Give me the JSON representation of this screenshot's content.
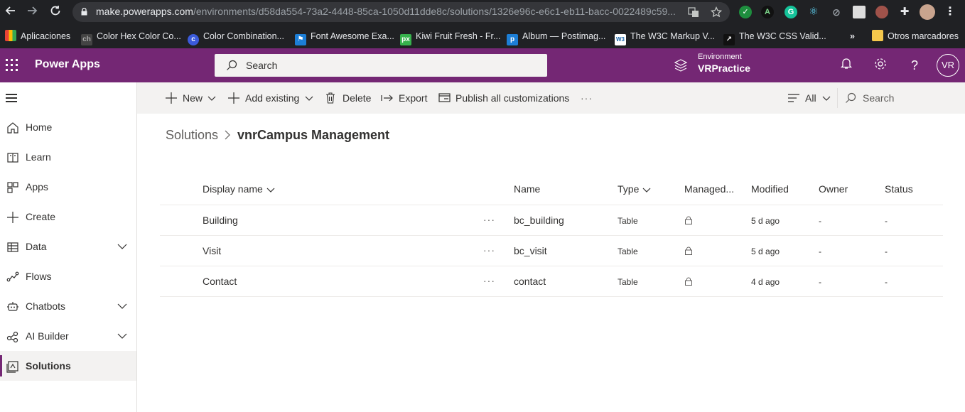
{
  "browser": {
    "url_host": "make.powerapps.com",
    "url_path": "/environments/d58da554-73a2-4448-85ca-1050d11dde8c/solutions/1326e96c-e6c1-eb11-bacc-0022489c59...",
    "bookmarks": [
      {
        "label": "Aplicaciones",
        "icon": "apps-grid-icon"
      },
      {
        "label": "Color Hex Color Co...",
        "icon": "colorhex-icon"
      },
      {
        "label": "Color Combination...",
        "icon": "colorcombo-icon"
      },
      {
        "label": "Font Awesome Exa...",
        "icon": "flag-icon"
      },
      {
        "label": "Kiwi Fruit Fresh - Fr...",
        "icon": "px-icon"
      },
      {
        "label": "Album — Postimag...",
        "icon": "postimage-icon"
      },
      {
        "label": "The W3C Markup V...",
        "icon": "w3c-icon"
      },
      {
        "label": "The W3C CSS Valid...",
        "icon": "w3c-css-icon"
      }
    ],
    "more_bookmarks": "»",
    "other_bookmarks": "Otros marcadores"
  },
  "app": {
    "name": "Power Apps",
    "search_placeholder": "Search",
    "environment_label": "Environment",
    "environment_name": "VRPractice",
    "avatar_initials": "VR",
    "brand_color": "#742774"
  },
  "nav": {
    "items": [
      {
        "label": "Home",
        "icon": "home-icon",
        "chevron": false
      },
      {
        "label": "Learn",
        "icon": "book-icon",
        "chevron": false
      },
      {
        "label": "Apps",
        "icon": "apps-icon",
        "chevron": false
      },
      {
        "label": "Create",
        "icon": "plus-icon",
        "chevron": false
      },
      {
        "label": "Data",
        "icon": "table-icon",
        "chevron": true
      },
      {
        "label": "Flows",
        "icon": "flow-icon",
        "chevron": false
      },
      {
        "label": "Chatbots",
        "icon": "bot-icon",
        "chevron": true
      },
      {
        "label": "AI Builder",
        "icon": "ai-builder-icon",
        "chevron": true
      },
      {
        "label": "Solutions",
        "icon": "solutions-icon",
        "chevron": false,
        "selected": true
      }
    ]
  },
  "commands": {
    "new": "New",
    "add_existing": "Add existing",
    "delete": "Delete",
    "export": "Export",
    "publish": "Publish all customizations",
    "more": "···",
    "filter": "All",
    "search": "Search"
  },
  "breadcrumb": {
    "root": "Solutions",
    "current": "vnrCampus Management"
  },
  "grid": {
    "columns": {
      "display_name": "Display name",
      "name": "Name",
      "type": "Type",
      "managed": "Managed...",
      "modified": "Modified",
      "owner": "Owner",
      "status": "Status"
    },
    "rows": [
      {
        "display_name": "Building",
        "more": "···",
        "name": "bc_building",
        "type": "Table",
        "modified": "5 d ago",
        "owner": "-",
        "status": "-"
      },
      {
        "display_name": "Visit",
        "more": "···",
        "name": "bc_visit",
        "type": "Table",
        "modified": "5 d ago",
        "owner": "-",
        "status": "-"
      },
      {
        "display_name": "Contact",
        "more": "···",
        "name": "contact",
        "type": "Table",
        "modified": "4 d ago",
        "owner": "-",
        "status": "-"
      }
    ]
  }
}
